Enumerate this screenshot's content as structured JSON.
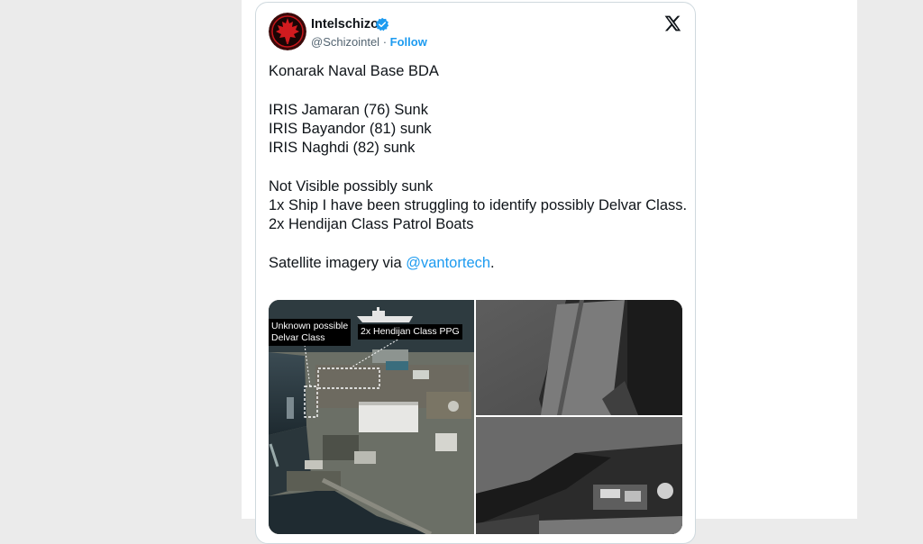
{
  "tweet": {
    "author_name": "Intelschizo",
    "author_handle": "@Schizointel",
    "separator": "·",
    "follow_label": "Follow",
    "lines": {
      "title": "Konarak Naval Base BDA",
      "ship1": "IRIS Jamaran (76) Sunk",
      "ship2": "IRIS Bayandor (81) sunk",
      "ship3": "IRIS Naghdi (82) sunk",
      "nv_heading": "Not Visible possibly sunk",
      "nv1": "1x Ship I have been struggling to identify possibly Delvar Class.",
      "nv2": "2x Hendijan Class Patrol Boats",
      "credit_prefix": "Satellite imagery via",
      "credit_mention": "@vantortech",
      "credit_suffix": "."
    }
  },
  "media": {
    "label_unknown_l1": "Unknown possible",
    "label_unknown_l2": "Delvar Class",
    "label_hendijan": "2x Hendijan Class PPG"
  },
  "colors": {
    "accent": "#1d9bf0",
    "text": "#0f1419",
    "muted": "#536471",
    "border": "#cfd9de"
  },
  "icons": [
    "avatar-maple-leaf-logo",
    "verified-badge-icon",
    "x-logo-icon"
  ]
}
